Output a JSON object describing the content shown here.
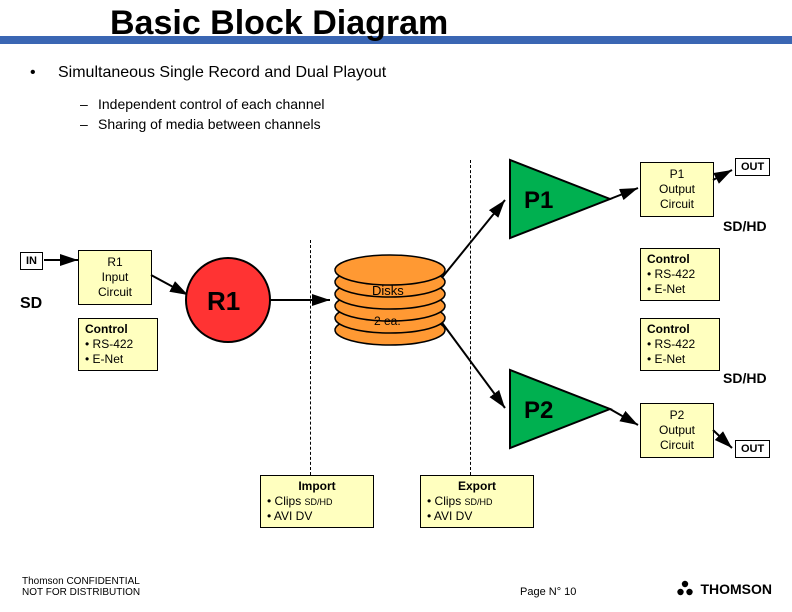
{
  "title": "Basic Block Diagram",
  "bullet": "Simultaneous Single Record and Dual Playout",
  "dash1": "Independent control of each channel",
  "dash2": "Sharing of media between channels",
  "inTag": "IN",
  "sdTag": "SD",
  "out1": "OUT",
  "out2": "OUT",
  "sdhd1": "SD/HD",
  "sdhd2": "SD/HD",
  "r1Label": "R1",
  "p1Label": "P1",
  "p2Label": "P2",
  "disksLabel": "Disks",
  "disksCount": "2 ea.",
  "r1InputLine1": "R1",
  "r1InputLine2": "Input",
  "r1InputLine3": "Circuit",
  "r1CtrlLine1": "Control",
  "r1CtrlLine2": "• RS-422",
  "r1CtrlLine3": "• E-Net",
  "p1OutLine1": "P1",
  "p1OutLine2": "Output",
  "p1OutLine3": "Circuit",
  "p1CtrlLine1": "Control",
  "p1CtrlLine2": "• RS-422",
  "p1CtrlLine3": "• E-Net",
  "p2CtrlLine1": "Control",
  "p2CtrlLine2": "• RS-422",
  "p2CtrlLine3": "• E-Net",
  "p2OutLine1": "P2",
  "p2OutLine2": "Output",
  "p2OutLine3": "Circuit",
  "importLine1": "Import",
  "importLine2": "• Clips ",
  "importLine2b": "SD/HD",
  "importLine3": "• AVI DV",
  "exportLine1": "Export",
  "exportLine2": "• Clips ",
  "exportLine2b": "SD/HD",
  "exportLine3": "• AVI DV",
  "footer1": "Thomson CONFIDENTIAL",
  "footer2": "NOT FOR DISTRIBUTION",
  "pageNum": "Page N° 10",
  "brand": "THOMSON"
}
